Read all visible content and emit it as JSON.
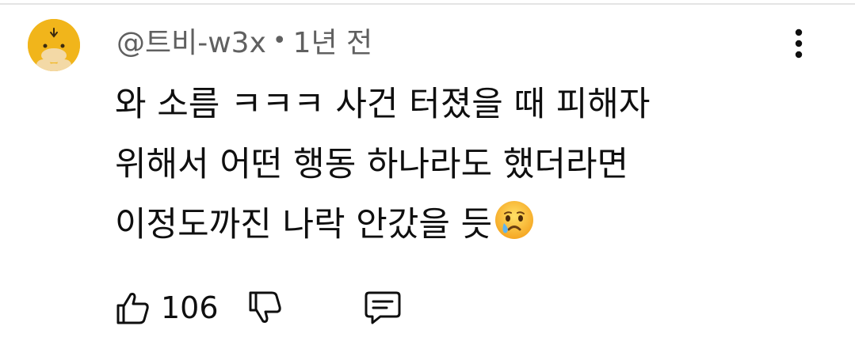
{
  "comment": {
    "author": "@트비-w3x",
    "separator": "•",
    "time": "1년 전",
    "body_lines": [
      "와 소름 ㅋㅋㅋ 사건 터졌을 때 피해자",
      "위해서 어떤 행동 하나라도 했더라면",
      "이정도까진 나락 안갔을 듯"
    ],
    "body_emoji": "crying-face-emoji",
    "like_count": "106"
  },
  "icons": {
    "avatar": "yellow-duck-avatar",
    "menu": "more-vertical-icon",
    "like": "thumbs-up-icon",
    "dislike": "thumbs-down-icon",
    "reply": "comment-icon"
  },
  "colors": {
    "text": "#0f0f0f",
    "meta": "#606060",
    "avatar_bg": "#f1b51b"
  }
}
